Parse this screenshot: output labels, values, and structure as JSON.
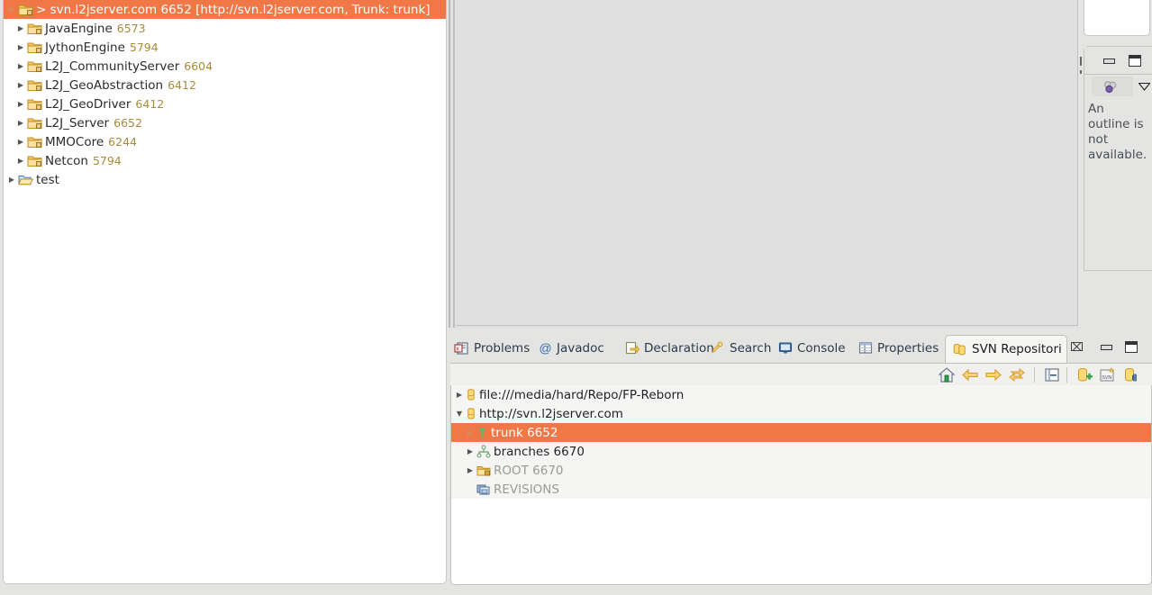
{
  "left_explorer": {
    "name": "package-explorer",
    "items": [
      {
        "label": "> svn.l2jserver.com 6652 [http://svn.l2jserver.com, Trunk: trunk]",
        "rev": "",
        "icon": "svn-project-icon",
        "selected": true,
        "level": 0,
        "arrow": "collapsed"
      },
      {
        "label": "JavaEngine",
        "rev": "6573",
        "icon": "svn-folder-icon",
        "selected": false,
        "level": 1,
        "arrow": "collapsed"
      },
      {
        "label": "JythonEngine",
        "rev": "5794",
        "icon": "svn-folder-icon",
        "selected": false,
        "level": 1,
        "arrow": "collapsed"
      },
      {
        "label": "L2J_CommunityServer",
        "rev": "6604",
        "icon": "svn-folder-icon",
        "selected": false,
        "level": 1,
        "arrow": "collapsed"
      },
      {
        "label": "L2J_GeoAbstraction",
        "rev": "6412",
        "icon": "svn-folder-icon",
        "selected": false,
        "level": 1,
        "arrow": "collapsed"
      },
      {
        "label": "L2J_GeoDriver",
        "rev": "6412",
        "icon": "svn-folder-icon",
        "selected": false,
        "level": 1,
        "arrow": "collapsed"
      },
      {
        "label": "L2J_Server",
        "rev": "6652",
        "icon": "svn-folder-icon",
        "selected": false,
        "level": 1,
        "arrow": "collapsed"
      },
      {
        "label": "MMOCore",
        "rev": "6244",
        "icon": "svn-folder-icon",
        "selected": false,
        "level": 1,
        "arrow": "collapsed"
      },
      {
        "label": "Netcon",
        "rev": "5794",
        "icon": "svn-folder-icon",
        "selected": false,
        "level": 1,
        "arrow": "collapsed"
      },
      {
        "label": "test",
        "rev": "",
        "icon": "open-folder-icon",
        "selected": false,
        "level": 0,
        "arrow": "collapsed"
      }
    ]
  },
  "outline_view": {
    "message": "An outline is not available.",
    "minimize_label": "Minimize",
    "maximize_label": "Maximize",
    "menu_label": "View Menu",
    "filter_icon": "outline-filter-icon"
  },
  "bottom_view_stack": {
    "tabs": [
      {
        "label": "Problems",
        "icon": "problems-icon",
        "active": false
      },
      {
        "label": "Javadoc",
        "icon": "javadoc-at-icon",
        "active": false
      },
      {
        "label": "Declaration",
        "icon": "declaration-icon",
        "active": false
      },
      {
        "label": "Search",
        "icon": "search-icon",
        "active": false
      },
      {
        "label": "Console",
        "icon": "console-icon",
        "active": false
      },
      {
        "label": "Properties",
        "icon": "properties-icon",
        "active": false
      },
      {
        "label": "SVN Repositori",
        "icon": "svn-repositories-icon",
        "active": true
      }
    ],
    "close_label": "⌧",
    "minimize_label": "Minimize",
    "maximize_label": "Maximize",
    "toolbar": [
      {
        "name": "home-icon",
        "title": "Go Home"
      },
      {
        "name": "back-arrow-icon",
        "title": "Back"
      },
      {
        "name": "forward-arrow-icon",
        "title": "Forward"
      },
      {
        "name": "refresh-icon",
        "title": "Refresh"
      },
      {
        "name": "collapse-all-icon",
        "title": "Collapse All"
      },
      {
        "name": "new-repository-location-icon",
        "title": "New Repository Location"
      },
      {
        "name": "new-svn-repository-icon",
        "title": "New Repository"
      },
      {
        "name": "repository-browse-icon",
        "title": "Browse Repository"
      }
    ]
  },
  "svn_repository_tree": {
    "rows": [
      {
        "label": "file:///media/hard/Repo/FP-Reborn",
        "icon": "repository-location-icon",
        "level": 1,
        "arrow": "collapsed",
        "selected": false,
        "grey": false
      },
      {
        "label": "http://svn.l2jserver.com",
        "icon": "repository-location-icon",
        "level": 1,
        "arrow": "expanded",
        "selected": false,
        "grey": false
      },
      {
        "label": "trunk 6652",
        "icon": "trunk-icon",
        "level": 2,
        "arrow": "collapsed",
        "selected": true,
        "grey": false
      },
      {
        "label": "branches 6670",
        "icon": "branches-icon",
        "level": 2,
        "arrow": "collapsed",
        "selected": false,
        "grey": false
      },
      {
        "label": "ROOT 6670",
        "icon": "root-folder-icon",
        "level": 2,
        "arrow": "collapsed",
        "selected": false,
        "grey": true
      },
      {
        "label": "REVISIONS",
        "icon": "revisions-icon",
        "level": 2,
        "arrow": "none",
        "selected": false,
        "grey": true
      }
    ]
  },
  "colors": {
    "selection": "#f07746",
    "revision_text": "#a98a3c",
    "panel_background": "#e4e4e2",
    "editor_background": "#e0e0e0",
    "row_background": "#f5f5f3"
  }
}
